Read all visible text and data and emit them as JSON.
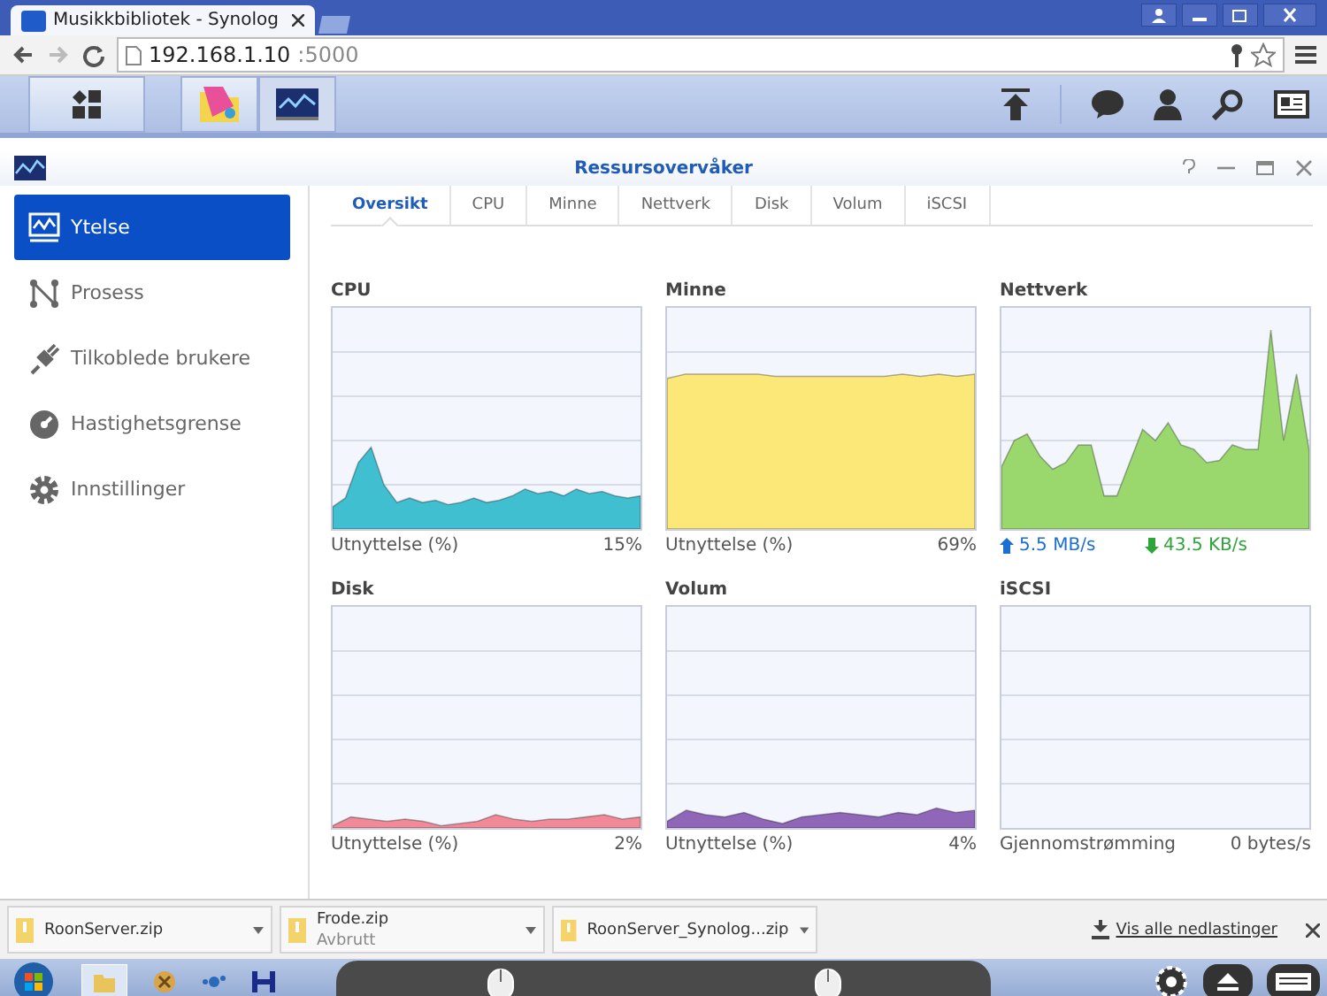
{
  "browser": {
    "tab_title": "Musikkbibliotek - Synolog",
    "url_host": "192.168.1.10",
    "url_port": ":5000"
  },
  "window": {
    "title": "Ressursovervåker"
  },
  "sidebar": {
    "items": [
      {
        "label": "Ytelse",
        "selected": true
      },
      {
        "label": "Prosess",
        "selected": false
      },
      {
        "label": "Tilkoblede brukere",
        "selected": false
      },
      {
        "label": "Hastighetsgrense",
        "selected": false
      },
      {
        "label": "Innstillinger",
        "selected": false
      }
    ]
  },
  "tabs": [
    {
      "label": "Oversikt",
      "selected": true
    },
    {
      "label": "CPU",
      "selected": false
    },
    {
      "label": "Minne",
      "selected": false
    },
    {
      "label": "Nettverk",
      "selected": false
    },
    {
      "label": "Disk",
      "selected": false
    },
    {
      "label": "Volum",
      "selected": false
    },
    {
      "label": "iSCSI",
      "selected": false
    }
  ],
  "panels": [
    {
      "title": "CPU",
      "kind": "usage",
      "color": "#3fbfd0",
      "footer_label": "Utnyttelse (%)",
      "footer_value": "15%"
    },
    {
      "title": "Minne",
      "kind": "usage",
      "color": "#fbe879",
      "footer_label": "Utnyttelse (%)",
      "footer_value": "69%"
    },
    {
      "title": "Nettverk",
      "kind": "network",
      "color": "#9ad86e",
      "upload": "5.5 MB/s",
      "download": "43.5 KB/s"
    },
    {
      "title": "Disk",
      "kind": "usage",
      "color": "#f08a98",
      "footer_label": "Utnyttelse (%)",
      "footer_value": "2%"
    },
    {
      "title": "Volum",
      "kind": "usage",
      "color": "#9066b8",
      "footer_label": "Utnyttelse (%)",
      "footer_value": "4%"
    },
    {
      "title": "iSCSI",
      "kind": "usage",
      "footer_label": "Gjennomstrømming",
      "footer_value": "0 bytes/s"
    }
  ],
  "downloads": {
    "items": [
      {
        "name": "RoonServer.zip"
      },
      {
        "name": "Frode.zip",
        "status": "Avbrutt"
      },
      {
        "name": "RoonServer_Synolog...zip"
      }
    ],
    "show_all": "Vis alle nedlastinger"
  }
}
